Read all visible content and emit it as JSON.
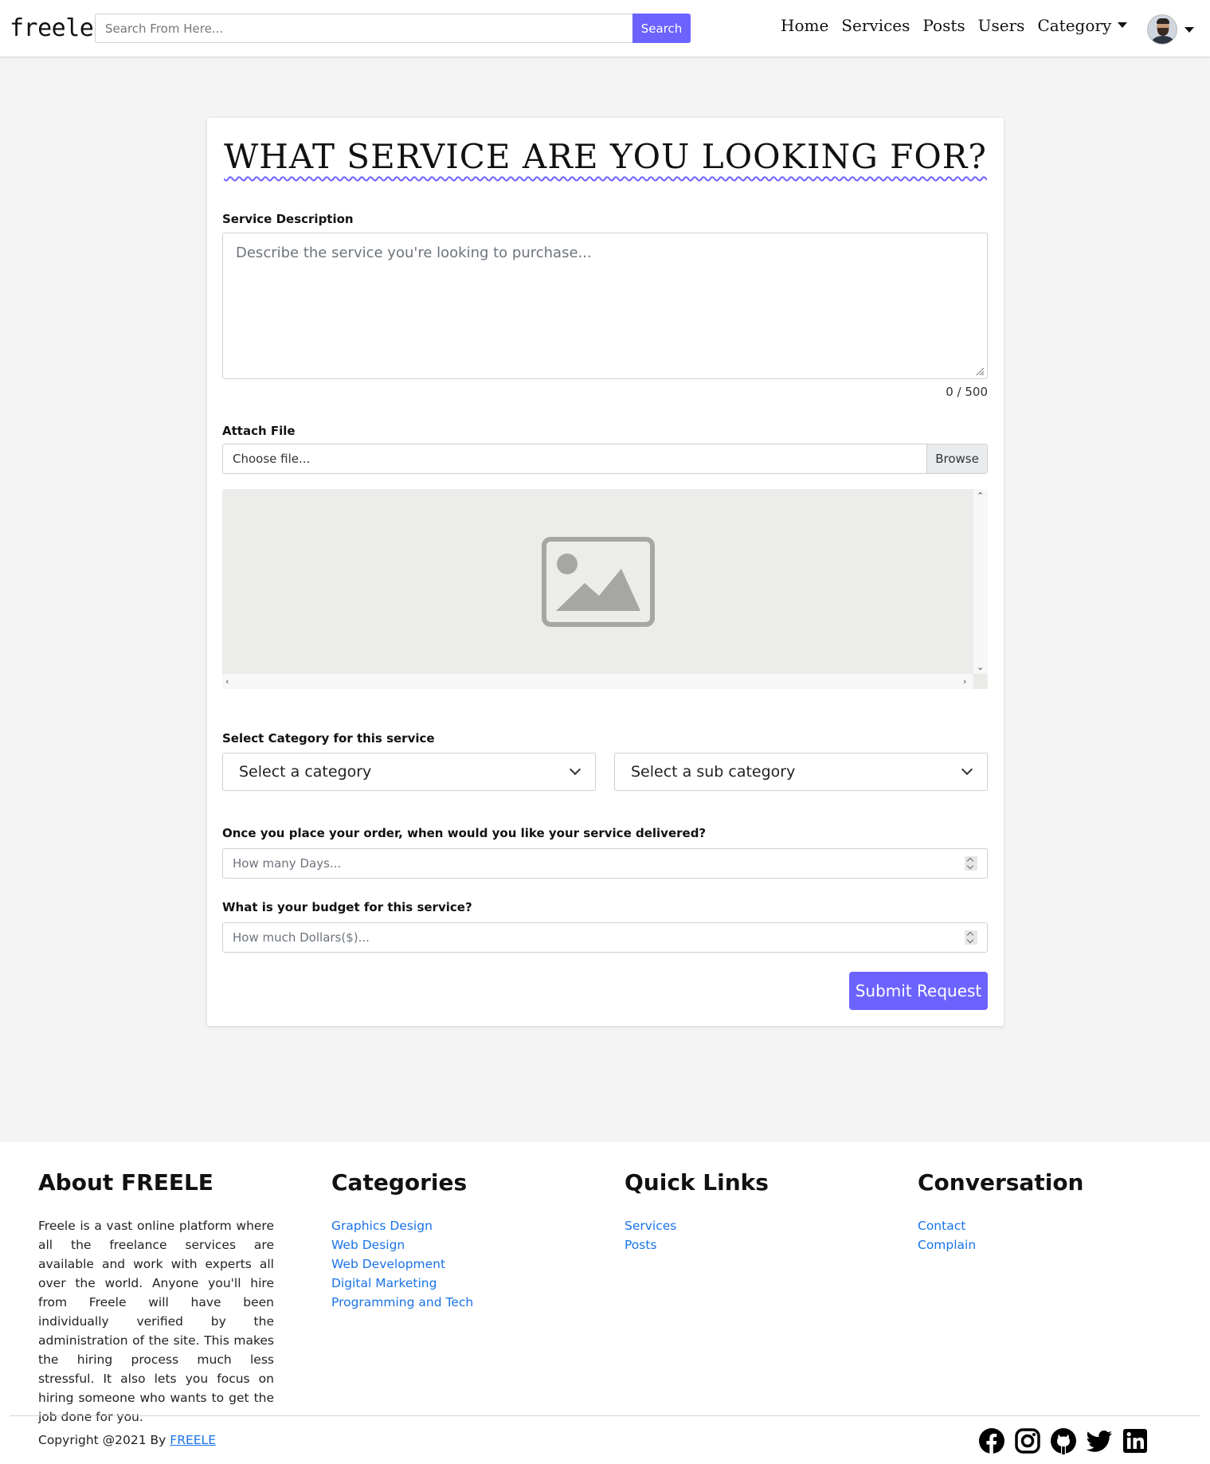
{
  "navbar": {
    "brand": "freele",
    "search_placeholder": "Search From Here...",
    "search_button": "Search",
    "links": [
      "Home",
      "Services",
      "Posts",
      "Users"
    ],
    "category_dropdown": "Category"
  },
  "form": {
    "title": "WHAT SERVICE ARE YOU LOOKING FOR?",
    "description_label": "Service Description",
    "description_placeholder": "Describe the service you're looking to purchase...",
    "counter": "0 / 500",
    "attach_label": "Attach File",
    "file_placeholder": "Choose file...",
    "browse_button": "Browse",
    "category_label": "Select Category for this service",
    "category_select": "Select a category",
    "subcategory_select": "Select a sub category",
    "delivery_label": "Once you place your order, when would you like your service delivered?",
    "delivery_placeholder": "How many Days...",
    "budget_label": "What is your budget for this service?",
    "budget_placeholder": "How much Dollars($)...",
    "submit_button": "Submit Request"
  },
  "footer": {
    "about_heading": "About FREELE",
    "about_text": "Freele is a vast online platform where all the freelance services are available and work with experts all over the world. Anyone you'll hire from Freele will have been individually verified by the administration of the site. This makes the hiring process much less stressful. It also lets you focus on hiring someone who wants to get the job done for you.",
    "categories_heading": "Categories",
    "categories": [
      "Graphics Design",
      "Web Design",
      "Web Development",
      "Digital Marketing",
      "Programming and Tech"
    ],
    "quicklinks_heading": "Quick Links",
    "quicklinks": [
      "Services",
      "Posts"
    ],
    "conversation_heading": "Conversation",
    "conversation": [
      "Contact",
      "Complain"
    ],
    "copyright_prefix": "Copyright @2021 By ",
    "copyright_link": "FREELE",
    "social_icons": [
      "facebook-icon",
      "instagram-icon",
      "github-icon",
      "twitter-icon",
      "linkedin-icon"
    ]
  },
  "colors": {
    "accent": "#6c63ff",
    "link": "#1a73e8",
    "page_bg": "#f4f4f4"
  }
}
